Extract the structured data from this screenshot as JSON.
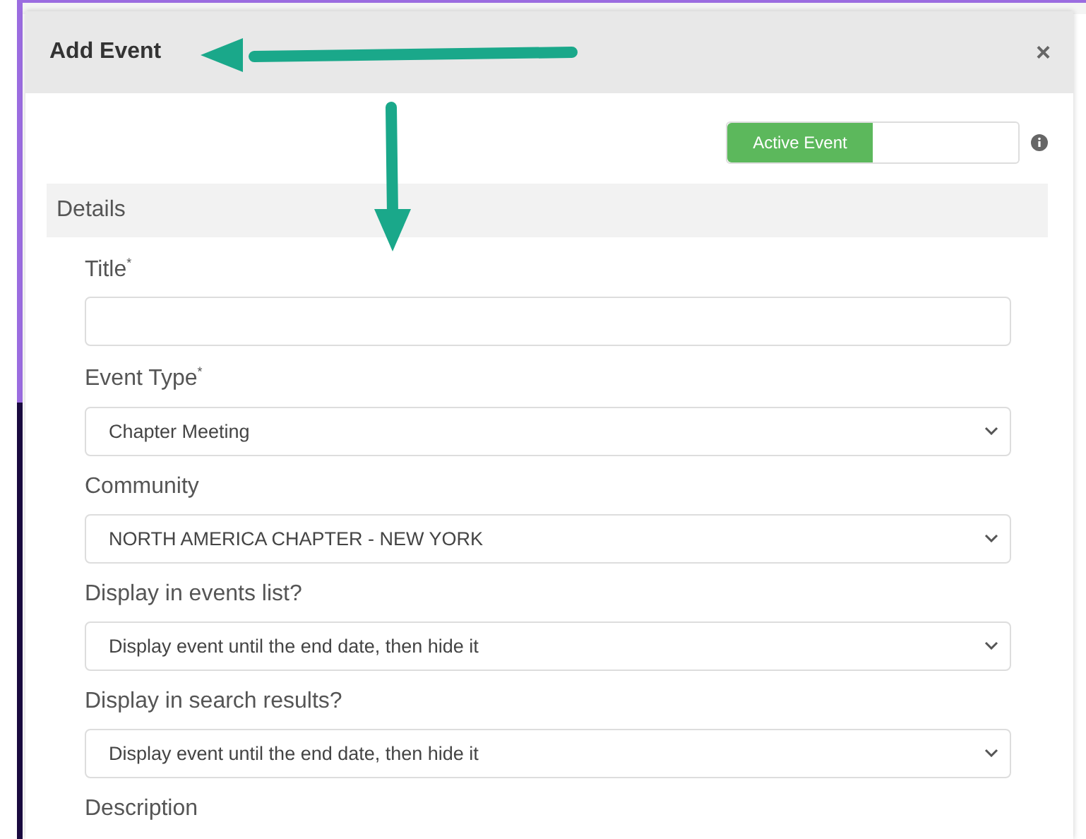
{
  "dialog": {
    "title": "Add Event",
    "close": "×"
  },
  "status_toggle": {
    "label": "Active Event",
    "on": true
  },
  "section": {
    "title": "Details"
  },
  "fields": [
    {
      "kind": "text",
      "label": "Title",
      "required_mark": "*"
    },
    {
      "kind": "select",
      "label": "Event Type",
      "required_mark": "*",
      "value": "Chapter Meeting"
    },
    {
      "kind": "select",
      "label": "Community",
      "value": "NORTH AMERICA CHAPTER - NEW YORK"
    },
    {
      "kind": "select",
      "label": "Display in events list?",
      "value": "Display event until the end date, then hide it"
    },
    {
      "kind": "select",
      "label": "Display in search results?",
      "value": "Display event until the end date, then hide it"
    },
    {
      "kind": "label",
      "label": "Description"
    }
  ]
}
